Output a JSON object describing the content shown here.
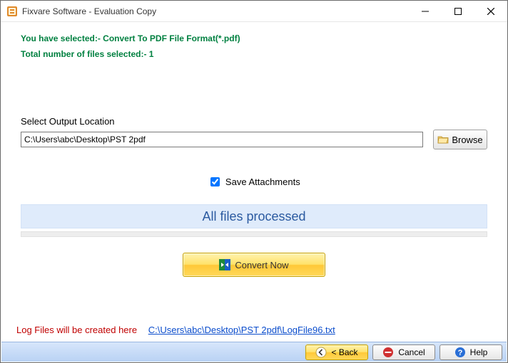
{
  "window": {
    "title": "Fixvare Software - Evaluation Copy"
  },
  "info": {
    "selection_line": "You have selected:- Convert To PDF File Format(*.pdf)",
    "total_files_line": "Total number of files selected:- 1"
  },
  "output": {
    "label": "Select Output Location",
    "path_value": "C:\\Users\\abc\\Desktop\\PST 2pdf",
    "browse_label": "Browse"
  },
  "options": {
    "save_attachments_label": "Save Attachments",
    "save_attachments_checked": true
  },
  "status": {
    "message": "All files processed"
  },
  "actions": {
    "convert_label": "Convert Now"
  },
  "log": {
    "label": "Log Files will be created here",
    "link_text": "C:\\Users\\abc\\Desktop\\PST 2pdf\\LogFile96.txt"
  },
  "footer": {
    "back_label": "< Back",
    "cancel_label": "Cancel",
    "help_label": "Help"
  }
}
